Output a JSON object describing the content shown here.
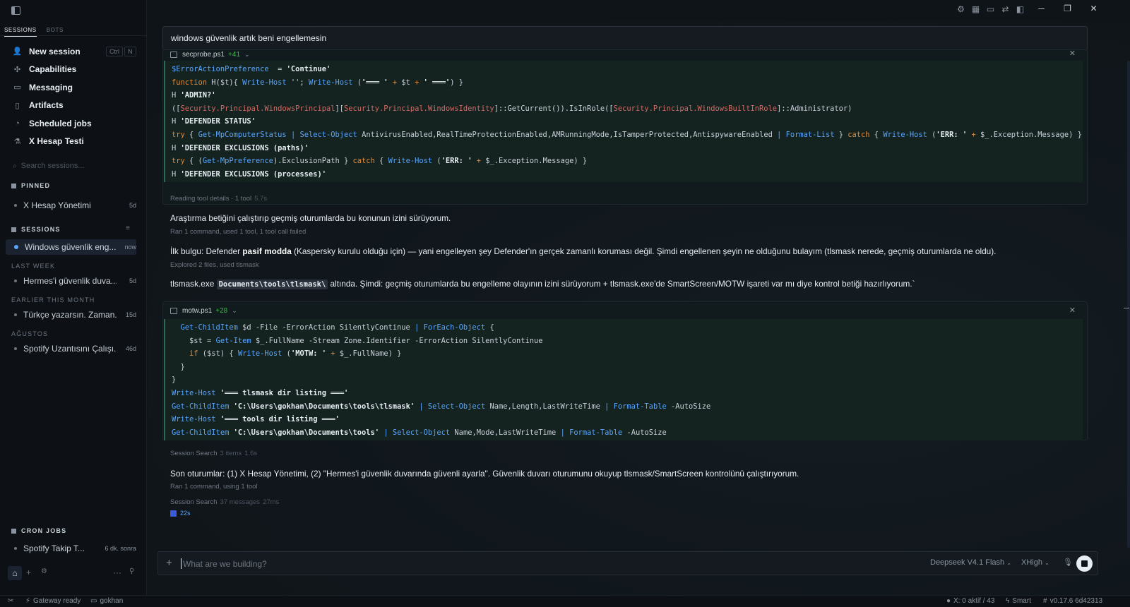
{
  "sidebar": {
    "tabs": [
      "SESSIONS",
      "BOTS"
    ],
    "nav": [
      {
        "label": "New session",
        "icon": "user-icon",
        "shortcut": [
          "Ctrl",
          "N"
        ]
      },
      {
        "label": "Capabilities",
        "icon": "puzzle-icon"
      },
      {
        "label": "Messaging",
        "icon": "message-icon"
      },
      {
        "label": "Artifacts",
        "icon": "file-icon"
      },
      {
        "label": "Scheduled jobs",
        "icon": "clock-icon"
      },
      {
        "label": "X Hesap Testi",
        "icon": "flask-icon"
      }
    ],
    "search_placeholder": "Search sessions...",
    "pinned_header": "PINNED",
    "pinned": [
      {
        "label": "X Hesap Yönetimi",
        "age": "5d"
      }
    ],
    "sessions_header": "SESSIONS",
    "active_session": {
      "label": "Windows güvenlik eng...",
      "age": "now"
    },
    "groups": [
      {
        "header": "LAST WEEK",
        "items": [
          {
            "label": "Hermes'i güvenlik duva...",
            "age": "5d"
          }
        ]
      },
      {
        "header": "EARLIER THIS MONTH",
        "items": [
          {
            "label": "Türkçe yazarsın. Zaman...",
            "age": "15d"
          }
        ]
      },
      {
        "header": "AĞUSTOS",
        "items": [
          {
            "label": "Spotify Uzantısını Çalışı...",
            "age": "46d"
          }
        ]
      }
    ],
    "cron_header": "CRON JOBS",
    "cron": [
      {
        "label": "Spotify Takip T...",
        "age": "6 dk. sonra"
      }
    ]
  },
  "main": {
    "prompt": "windows güvenlik artık beni engellemesin",
    "card1": {
      "filename": "secprobe.ps1",
      "diff": "+41",
      "lines": [
        [
          [
            "cm",
            "$ErrorActionPreference"
          ],
          [
            "",
            "  = "
          ],
          [
            "st",
            "'Continue'"
          ]
        ],
        [
          [
            "kw",
            "function"
          ],
          [
            "",
            " H($t){ "
          ],
          [
            "cm",
            "Write-Host"
          ],
          [
            "",
            " ''; "
          ],
          [
            "cm",
            "Write-Host"
          ],
          [
            "",
            " ("
          ],
          [
            "st",
            "'═══ '"
          ],
          [
            "",
            " "
          ],
          [
            "kw",
            "+"
          ],
          [
            "",
            " $t "
          ],
          [
            "kw",
            "+"
          ],
          [
            "",
            " "
          ],
          [
            "st",
            "' ═══'"
          ],
          [
            "",
            ") }"
          ]
        ],
        [
          [
            "",
            "H "
          ],
          [
            "st",
            "'ADMIN?'"
          ]
        ],
        [
          [
            "",
            "(["
          ],
          [
            "ty",
            "Security.Principal.WindowsPrincipal"
          ],
          [
            "",
            "]["
          ],
          [
            "ty",
            "Security.Principal.WindowsIdentity"
          ],
          [
            "",
            "]::GetCurrent()).IsInRole(["
          ],
          [
            "ty",
            "Security.Principal.WindowsBuiltInRole"
          ],
          [
            "",
            "]::Administrator)"
          ]
        ],
        [
          [
            "",
            "H "
          ],
          [
            "st",
            "'DEFENDER STATUS'"
          ]
        ],
        [
          [
            "kw",
            "try"
          ],
          [
            "",
            " { "
          ],
          [
            "cm",
            "Get-MpComputerStatus"
          ],
          [
            "",
            " "
          ],
          [
            "cm",
            "|"
          ],
          [
            "",
            " "
          ],
          [
            "cm",
            "Select-Object"
          ],
          [
            "",
            " AntivirusEnabled,RealTimeProtectionEnabled,AMRunningMode,IsTamperProtected,AntispywareEnabled "
          ],
          [
            "cm",
            "|"
          ],
          [
            "",
            " "
          ],
          [
            "cm",
            "Format-List"
          ],
          [
            "",
            " } "
          ],
          [
            "kw",
            "catch"
          ],
          [
            "",
            " { "
          ],
          [
            "cm",
            "Write-Host"
          ],
          [
            "",
            " ("
          ],
          [
            "st",
            "'ERR: '"
          ],
          [
            "",
            " "
          ],
          [
            "kw",
            "+"
          ],
          [
            "",
            " $_.Exception.Message) }"
          ]
        ],
        [
          [
            "",
            "H "
          ],
          [
            "st",
            "'DEFENDER EXCLUSIONS (paths)'"
          ]
        ],
        [
          [
            "kw",
            "try"
          ],
          [
            "",
            " { ("
          ],
          [
            "cm",
            "Get-MpPreference"
          ],
          [
            "",
            ").ExclusionPath } "
          ],
          [
            "kw",
            "catch"
          ],
          [
            "",
            " { "
          ],
          [
            "cm",
            "Write-Host"
          ],
          [
            "",
            " ("
          ],
          [
            "st",
            "'ERR: '"
          ],
          [
            "",
            " "
          ],
          [
            "kw",
            "+"
          ],
          [
            "",
            " $_.Exception.Message) }"
          ]
        ],
        [
          [
            "",
            "H "
          ],
          [
            "st",
            "'DEFENDER EXCLUSIONS (processes)'"
          ]
        ]
      ]
    },
    "meta1": {
      "text": "Reading tool details · 1 tool",
      "time": "5.7s"
    },
    "para1": "Araştırma betiğini çalıştırıp geçmiş oturumlarda bu konunun izini sürüyorum.",
    "meta2": "Ran 1 command, used 1 tool, 1 tool call failed",
    "para2": {
      "pre": "İlk bulgu: Defender ",
      "bold": "pasif modda",
      "post": " (Kaspersky kurulu olduğu için) — yani engelleyen şey Defender'ın gerçek zamanlı koruması değil. Şimdi engellenen şeyin ne olduğunu bulayım (tlsmask nerede, geçmiş oturumlarda ne oldu)."
    },
    "meta3": "Explored 2 files, used tlsmask",
    "para3": {
      "pre": "tlsmask.exe ",
      "code": "Documents\\tools\\tlsmask\\",
      "post": " altında. Şimdi: geçmiş oturumlarda bu engelleme olayının izini sürüyorum + tlsmask.exe'de SmartScreen/MOTW işareti var mı diye kontrol betiği hazırlıyorum.`"
    },
    "card2": {
      "filename": "motw.ps1",
      "diff": "+28",
      "lines": [
        [
          [
            "",
            "  "
          ],
          [
            "cm",
            "Get-ChildItem"
          ],
          [
            "",
            " $d -File -ErrorAction SilentlyContinue "
          ],
          [
            "cm",
            "|"
          ],
          [
            "",
            " "
          ],
          [
            "cm",
            "ForEach-Object"
          ],
          [
            "",
            " {"
          ]
        ],
        [
          [
            "",
            "    $st = "
          ],
          [
            "cm",
            "Get-Item"
          ],
          [
            "",
            " $_.FullName -Stream Zone.Identifier -ErrorAction SilentlyContinue"
          ]
        ],
        [
          [
            "",
            "    "
          ],
          [
            "kw",
            "if"
          ],
          [
            "",
            " ($st) { "
          ],
          [
            "cm",
            "Write-Host"
          ],
          [
            "",
            " ("
          ],
          [
            "st",
            "'MOTW: '"
          ],
          [
            "",
            " "
          ],
          [
            "kw",
            "+"
          ],
          [
            "",
            " $_.FullName) }"
          ]
        ],
        [
          [
            "",
            "  }"
          ]
        ],
        [
          [
            "",
            "}"
          ]
        ],
        [
          [
            "cm",
            "Write-Host"
          ],
          [
            "",
            " "
          ],
          [
            "st",
            "'═══ tlsmask dir listing ═══'"
          ]
        ],
        [
          [
            "cm",
            "Get-ChildItem"
          ],
          [
            "",
            " "
          ],
          [
            "st",
            "'C:\\Users\\gokhan\\Documents\\tools\\tlsmask'"
          ],
          [
            "",
            " "
          ],
          [
            "cm",
            "|"
          ],
          [
            "",
            " "
          ],
          [
            "cm",
            "Select-Object"
          ],
          [
            "",
            " Name,Length,LastWriteTime "
          ],
          [
            "cm",
            "|"
          ],
          [
            "",
            " "
          ],
          [
            "cm",
            "Format-Table"
          ],
          [
            "",
            " -AutoSize"
          ]
        ],
        [
          [
            "cm",
            "Write-Host"
          ],
          [
            "",
            " "
          ],
          [
            "st",
            "'═══ tools dir listing ═══'"
          ]
        ],
        [
          [
            "cm",
            "Get-ChildItem"
          ],
          [
            "",
            " "
          ],
          [
            "st",
            "'C:\\Users\\gokhan\\Documents\\tools'"
          ],
          [
            "",
            " "
          ],
          [
            "cm",
            "|"
          ],
          [
            "",
            " "
          ],
          [
            "cm",
            "Select-Object"
          ],
          [
            "",
            " Name,Mode,LastWriteTime "
          ],
          [
            "cm",
            "|"
          ],
          [
            "",
            " "
          ],
          [
            "cm",
            "Format-Table"
          ],
          [
            "",
            " -AutoSize"
          ]
        ]
      ]
    },
    "meta4": {
      "text": "Session Search",
      "items": "3 items",
      "time": "1.6s"
    },
    "para4": "Son oturumlar: (1) X Hesap Yönetimi, (2) \"Hermes'i güvenlik duvarında güvenli ayarla\". Güvenlik duvarı oturumunu okuyup tlsmask/SmartScreen kontrolünü çalıştırıyorum.",
    "meta5": "Ran 1 command, using 1 tool",
    "meta6": {
      "text": "Session Search",
      "items": "37 messages",
      "time": "27ms"
    },
    "chip": "22s"
  },
  "composer": {
    "placeholder": "What are we building?",
    "model": "Deepseek V4.1 Flash",
    "effort": "XHigh"
  },
  "statusbar": {
    "gateway": "Gateway ready",
    "folder": "gokhan",
    "x_active": "X: 0 aktif / 43",
    "mode": "Smart",
    "version": "v0.17.6 6d42313"
  },
  "colors": {
    "keyword": "#e38c3a",
    "command": "#58a6ff",
    "type": "#d46a64",
    "diff_add": "#3fb950"
  }
}
